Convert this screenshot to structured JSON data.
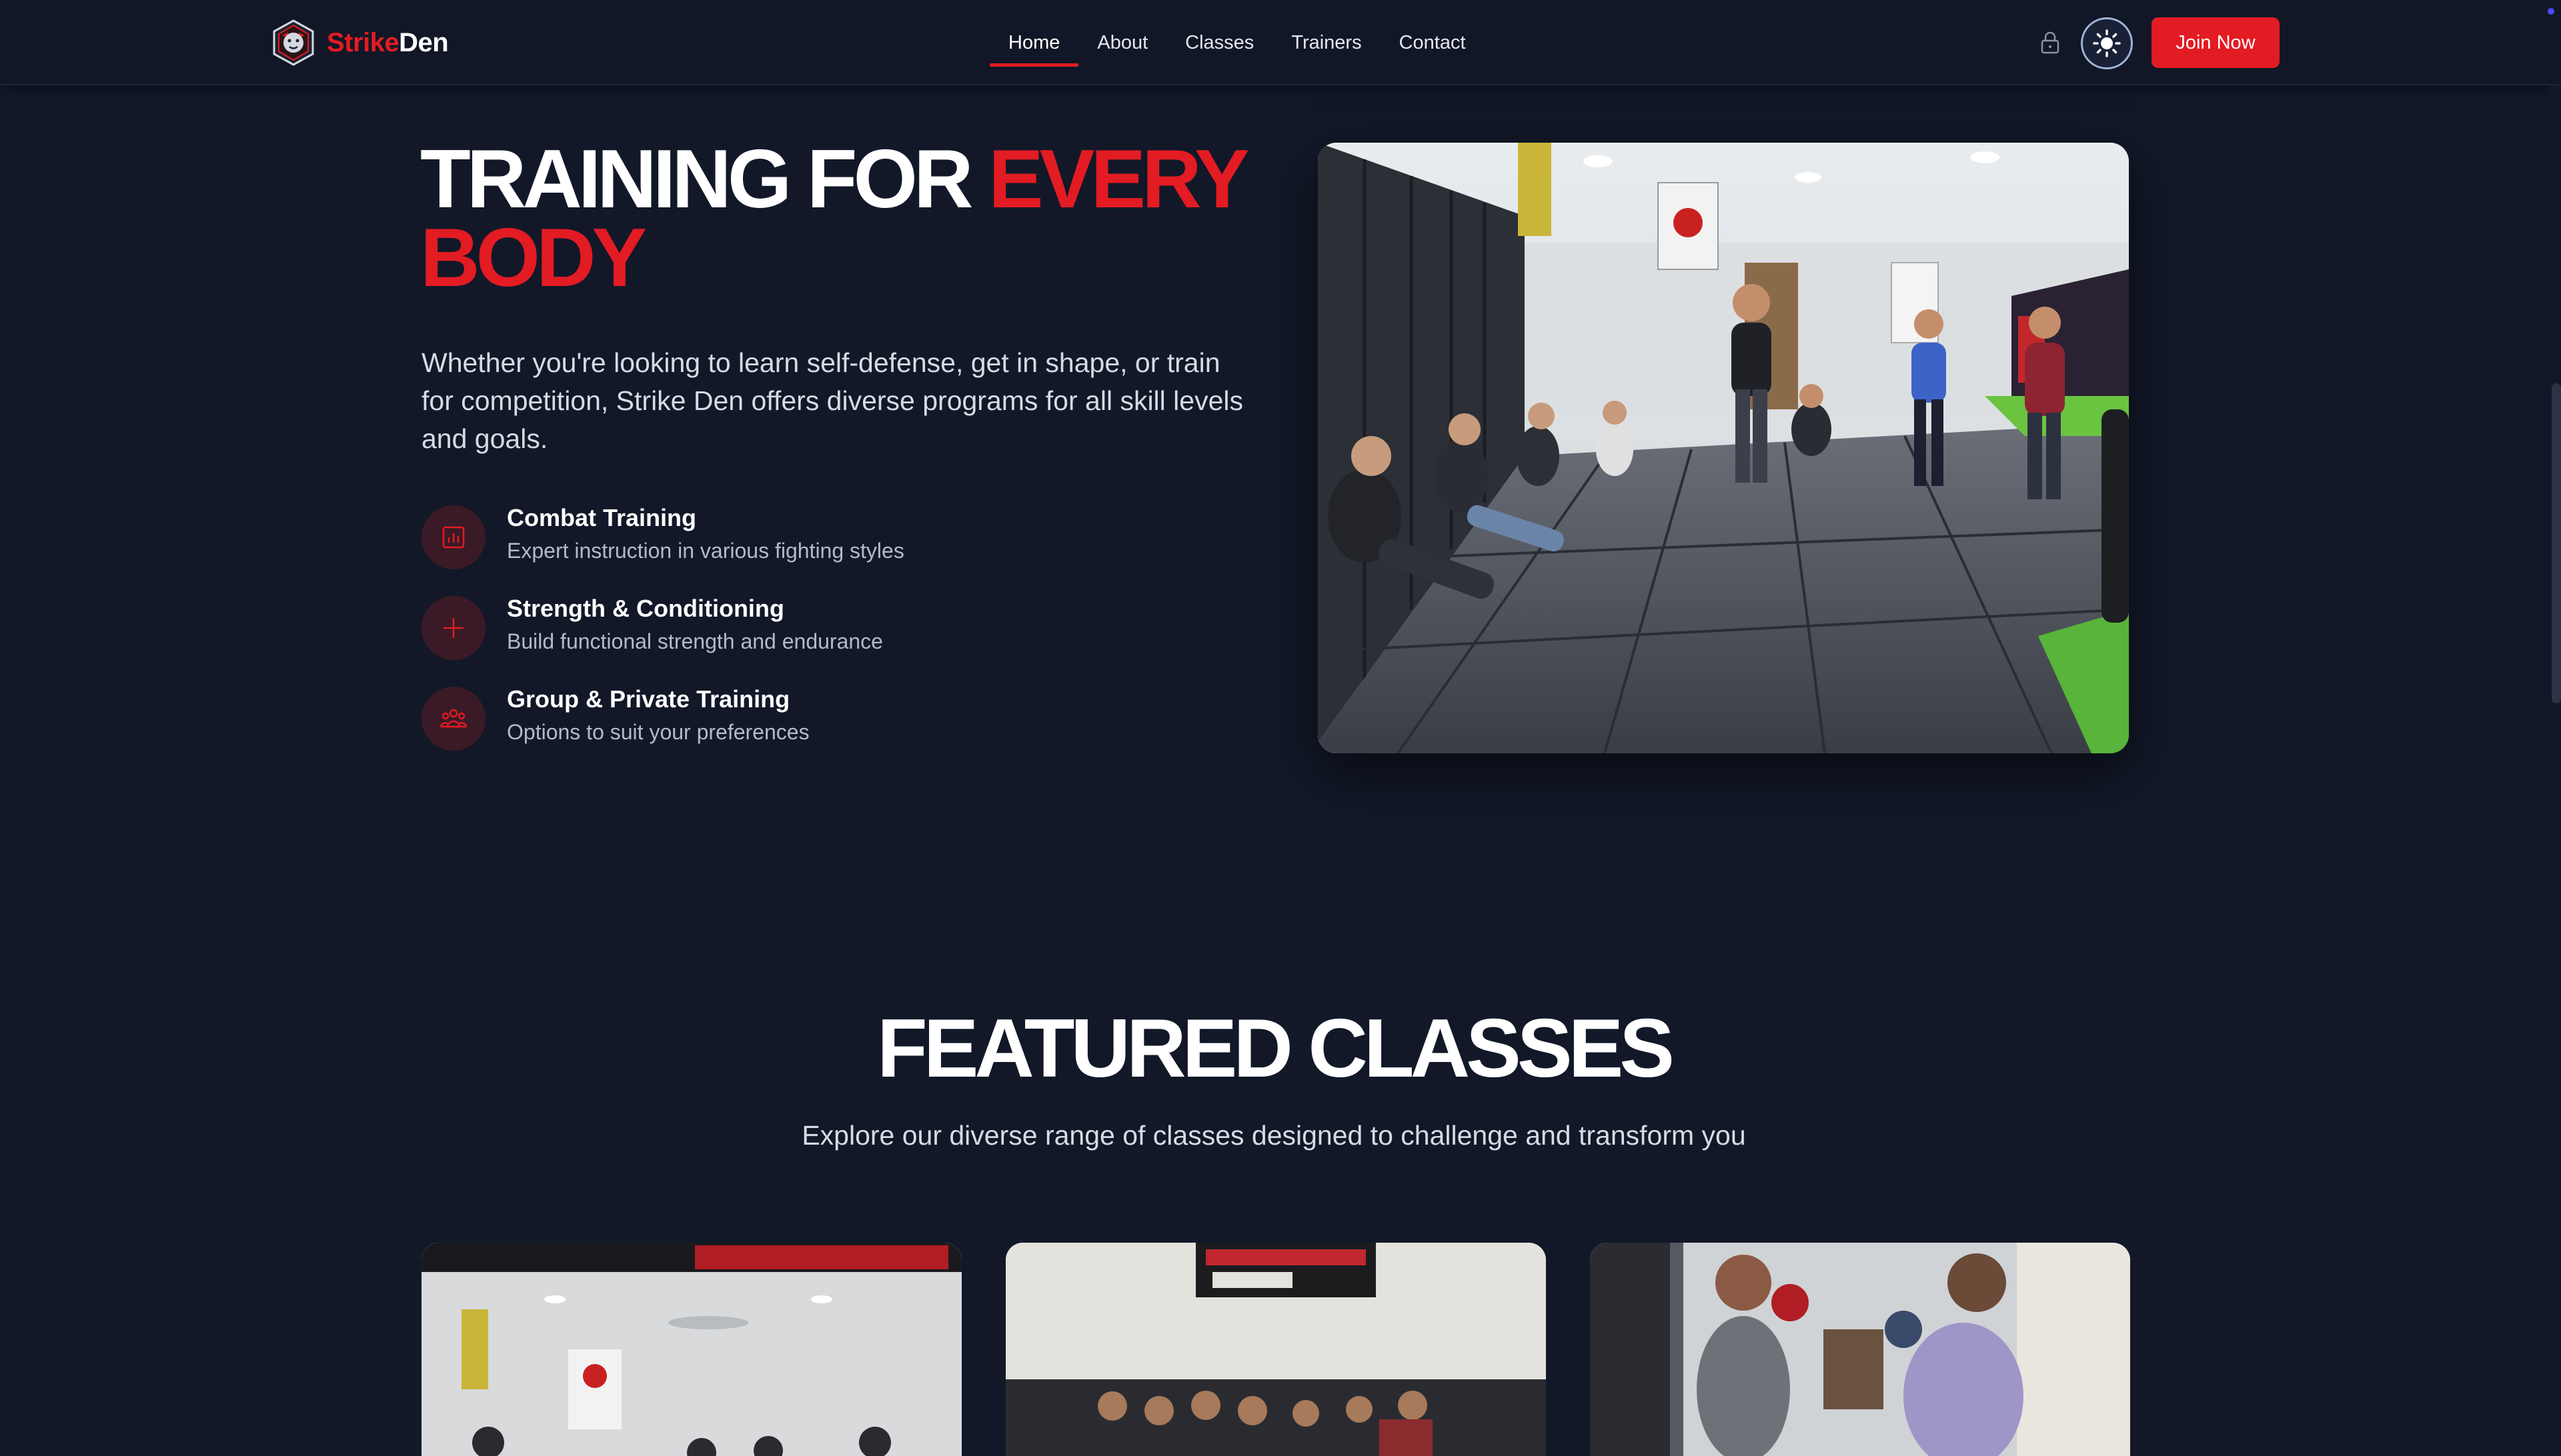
{
  "brand": {
    "name_part1": "Strike",
    "name_part2": "Den",
    "logo_icon": "lion-head-logo-icon"
  },
  "nav": {
    "links": [
      {
        "label": "Home",
        "active": true
      },
      {
        "label": "About",
        "active": false
      },
      {
        "label": "Classes",
        "active": false
      },
      {
        "label": "Trainers",
        "active": false
      },
      {
        "label": "Contact",
        "active": false
      }
    ],
    "lock_icon": "lock-icon",
    "theme_icon": "sun-icon",
    "join_label": "Join Now"
  },
  "hero": {
    "title_part1": "TRAINING FOR ",
    "title_accent": "EVERY BODY",
    "description": "Whether you're looking to learn self-defense, get in shape, or train for competition, Strike Den offers diverse programs for all skill levels and goals.",
    "features": [
      {
        "title": "Combat Training",
        "subtitle": "Expert instruction in various fighting styles",
        "icon": "chart-icon"
      },
      {
        "title": "Strength & Conditioning",
        "subtitle": "Build functional strength and endurance",
        "icon": "plus-icon"
      },
      {
        "title": "Group & Private Training",
        "subtitle": "Options to suit your preferences",
        "icon": "group-icon"
      }
    ]
  },
  "featured": {
    "title": "FEATURED CLASSES",
    "subtitle": "Explore our diverse range of classes designed to challenge and transform you"
  },
  "colors": {
    "accent": "#e31b23",
    "background": "#121828",
    "navbar": "#111726"
  }
}
